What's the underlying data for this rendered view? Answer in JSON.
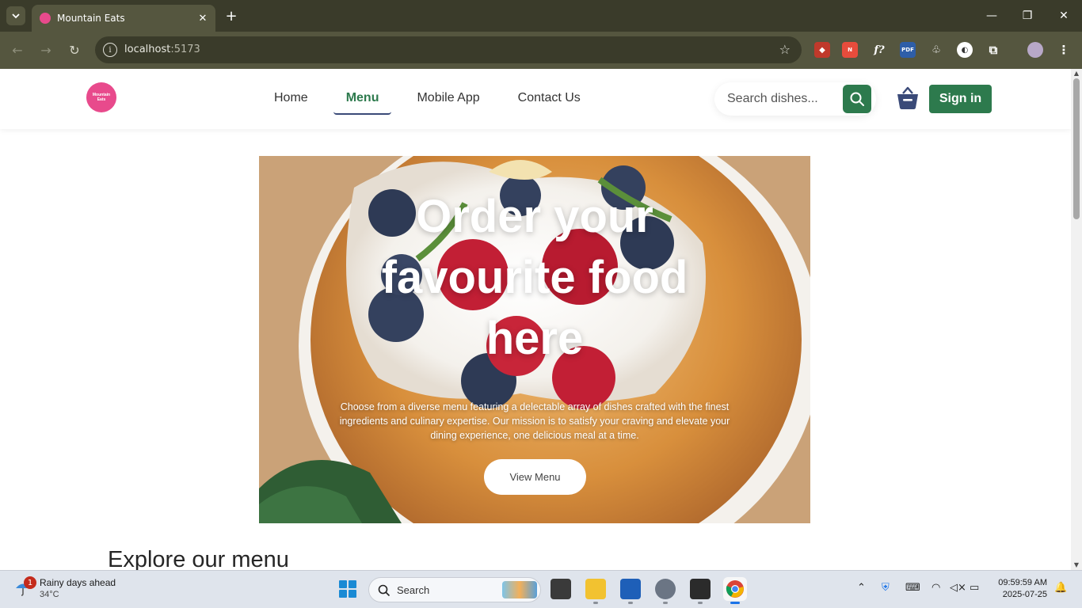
{
  "browser": {
    "tab_title": "Mountain Eats",
    "url_host": "localhost",
    "url_port": ":5173"
  },
  "header": {
    "logo_line1": "Mountain",
    "logo_line2": "Eats",
    "nav": [
      "Home",
      "Menu",
      "Mobile App",
      "Contact Us"
    ],
    "active_nav": "Menu",
    "search_placeholder": "Search dishes...",
    "signin_label": "Sign in"
  },
  "hero": {
    "title": "Order your favourite food here",
    "description": "Choose from a diverse menu featuring a delectable array of dishes crafted with the finest ingredients and culinary expertise. Our mission is to satisfy your craving and elevate your dining experience, one delicious meal at a time.",
    "button_label": "View Menu"
  },
  "section": {
    "explore_title": "Explore our menu"
  },
  "taskbar": {
    "weather_title": "Rainy days ahead",
    "weather_temp": "34°C",
    "weather_badge": "1",
    "search_label": "Search",
    "time": "09:59:59 AM",
    "date": "2025-07-25"
  },
  "colors": {
    "brand_green": "#2d7a4d",
    "logo_pink": "#e84a8c",
    "nav_underline": "#3a4a78"
  }
}
